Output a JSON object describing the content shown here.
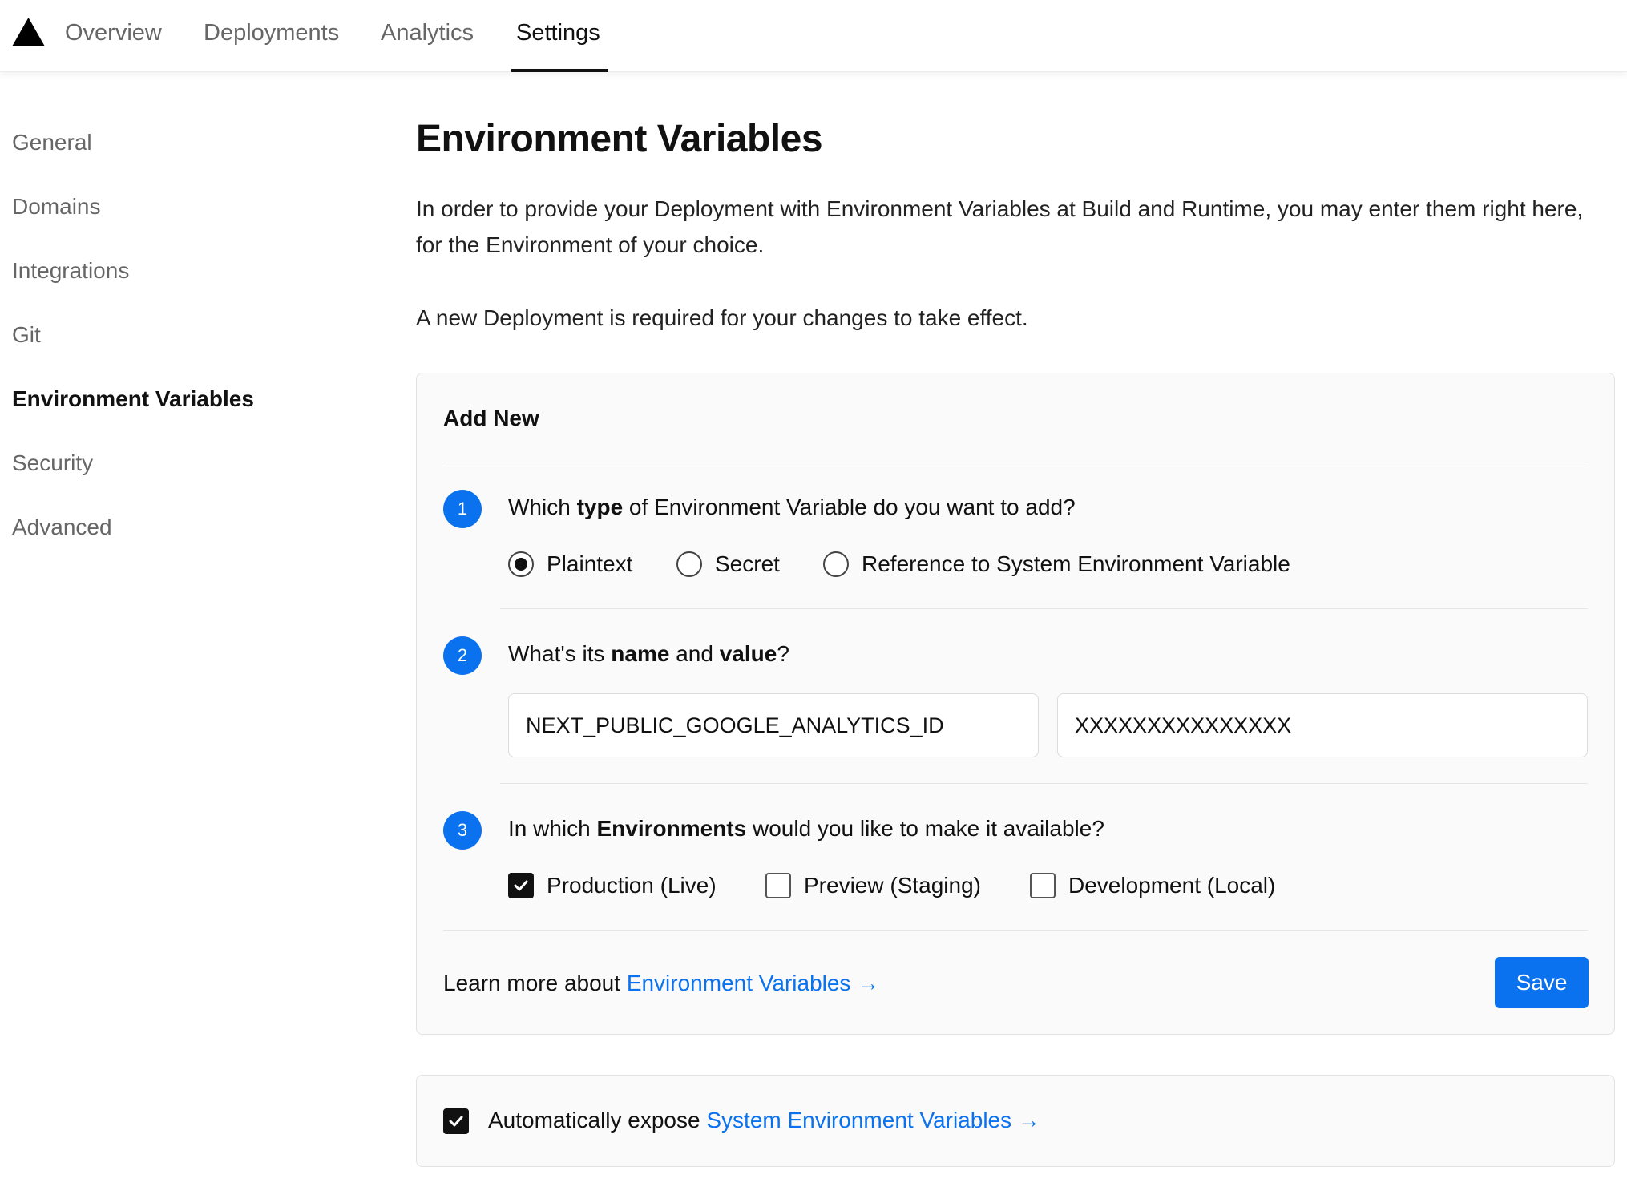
{
  "nav": {
    "tabs": [
      {
        "label": "Overview"
      },
      {
        "label": "Deployments"
      },
      {
        "label": "Analytics"
      },
      {
        "label": "Settings"
      }
    ],
    "active_tab": "Settings"
  },
  "sidebar": {
    "items": [
      {
        "label": "General"
      },
      {
        "label": "Domains"
      },
      {
        "label": "Integrations"
      },
      {
        "label": "Git"
      },
      {
        "label": "Environment Variables"
      },
      {
        "label": "Security"
      },
      {
        "label": "Advanced"
      }
    ],
    "active_item": "Environment Variables"
  },
  "main": {
    "title": "Environment Variables",
    "intro": "In order to provide your Deployment with Environment Variables at Build and Runtime, you may enter them right here, for the Environment of your choice.",
    "note": "A new Deployment is required for your changes to take effect."
  },
  "add_new": {
    "title": "Add New",
    "step1": {
      "number": "1",
      "q_prefix": "Which ",
      "q_bold": "type",
      "q_suffix": " of Environment Variable do you want to add?",
      "options": [
        {
          "label": "Plaintext",
          "checked": true
        },
        {
          "label": "Secret",
          "checked": false
        },
        {
          "label": "Reference to System Environment Variable",
          "checked": false
        }
      ]
    },
    "step2": {
      "number": "2",
      "q_prefix": "What's its ",
      "q_bold1": "name",
      "q_mid": " and ",
      "q_bold2": "value",
      "q_suffix": "?",
      "name_value": "NEXT_PUBLIC_GOOGLE_ANALYTICS_ID",
      "value_value": "XXXXXXXXXXXXXXX"
    },
    "step3": {
      "number": "3",
      "q_prefix": "In which ",
      "q_bold": "Environments",
      "q_suffix": " would you like to make it available?",
      "options": [
        {
          "label": "Production (Live)",
          "checked": true
        },
        {
          "label": "Preview (Staging)",
          "checked": false
        },
        {
          "label": "Development (Local)",
          "checked": false
        }
      ]
    },
    "footer": {
      "learn_prefix": "Learn more about ",
      "learn_link": "Environment Variables →",
      "save_label": "Save"
    }
  },
  "auto_expose": {
    "checked": true,
    "prefix": "Automatically expose ",
    "link": "System Environment Variables →"
  },
  "colors": {
    "accent": "#0a72ef",
    "text": "#111111",
    "muted": "#666666",
    "card_bg": "#fafafa"
  },
  "icons": {
    "logo": "triangle-logo-icon",
    "check": "checkmark-icon"
  }
}
